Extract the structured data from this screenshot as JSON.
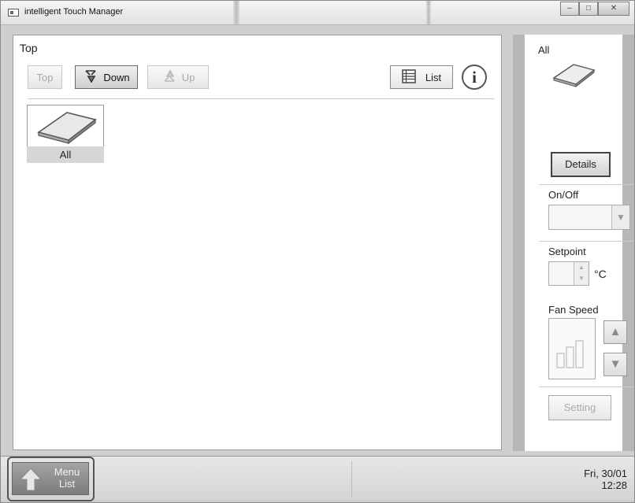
{
  "window": {
    "title": "intelligent Touch Manager",
    "minimize": "–",
    "maximize": "□",
    "close": "✕"
  },
  "main": {
    "breadcrumb": "Top",
    "toolbar": {
      "top_label": "Top",
      "down_label": "Down",
      "up_label": "Up",
      "list_label": "List",
      "info_label": "i"
    },
    "group_tile": {
      "label": "All"
    }
  },
  "side": {
    "selected_name": "All",
    "details_label": "Details",
    "onoff_label": "On/Off",
    "onoff_value": "",
    "setpoint_label": "Setpoint",
    "setpoint_value": "",
    "setpoint_unit": "°C",
    "fan_speed_label": "Fan Speed",
    "setting_label": "Setting"
  },
  "bottom": {
    "menu_label_line1": "Menu",
    "menu_label_line2": "List",
    "date": "Fri, 30/01",
    "time": "12:28"
  }
}
